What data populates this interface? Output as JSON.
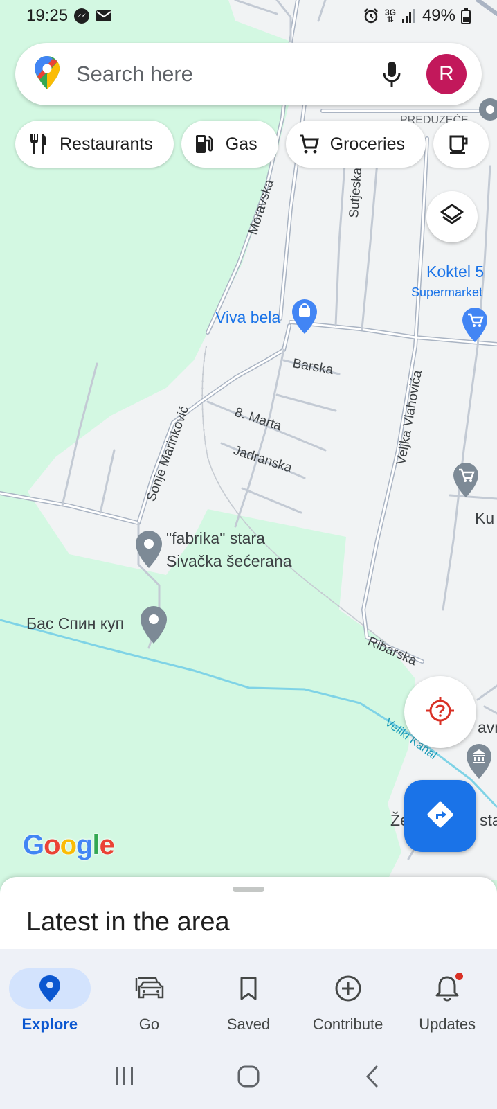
{
  "status_bar": {
    "time": "19:25",
    "battery": "49%",
    "network": "3G",
    "icons": [
      "messenger-icon",
      "email-icon",
      "alarm-icon",
      "network-3g-icon",
      "signal-icon",
      "battery-icon"
    ]
  },
  "search": {
    "placeholder": "Search here",
    "avatar_letter": "R",
    "avatar_color": "#c2185b"
  },
  "chips": [
    {
      "label": "Restaurants",
      "icon": "restaurant-icon"
    },
    {
      "label": "Gas",
      "icon": "gas-station-icon"
    },
    {
      "label": "Groceries",
      "icon": "cart-icon"
    },
    {
      "label": "",
      "icon": "coffee-icon"
    }
  ],
  "map": {
    "streets": [
      "Moravska",
      "Sutjeska",
      "Barska",
      "8. Marta",
      "Jadranska",
      "Sonje Marinković",
      "Veljka Vlahovića",
      "Ribarska"
    ],
    "water": [
      "Veliki Kanal"
    ],
    "places": [
      {
        "name": "Viva bela",
        "type": "shopping"
      },
      {
        "name": "Koktel 5",
        "sub": "Supermarket",
        "type": "grocery"
      },
      {
        "name": "\"fabrika\" stara",
        "name2": "Sivačka šećerana",
        "type": "place"
      },
      {
        "name": "Бас Спин куп",
        "type": "place"
      }
    ],
    "partial_labels": [
      "PREDUZEĆE",
      "Ku",
      "avn",
      "Že",
      "sta"
    ],
    "brand": "Google"
  },
  "bottom_sheet": {
    "title": "Latest in the area"
  },
  "nav": {
    "items": [
      {
        "label": "Explore",
        "icon": "location-pin-icon",
        "active": true
      },
      {
        "label": "Go",
        "icon": "car-icon",
        "active": false
      },
      {
        "label": "Saved",
        "icon": "bookmark-icon",
        "active": false
      },
      {
        "label": "Contribute",
        "icon": "plus-circle-icon",
        "active": false
      },
      {
        "label": "Updates",
        "icon": "bell-icon",
        "active": false,
        "badge": true
      }
    ]
  },
  "colors": {
    "accent_blue": "#1a73e8",
    "map_green": "#d3f8e2",
    "map_urban": "#f1f3f4",
    "road": "#aab4c3",
    "water": "#7fd3e6",
    "nav_bg": "#eef1f7"
  }
}
